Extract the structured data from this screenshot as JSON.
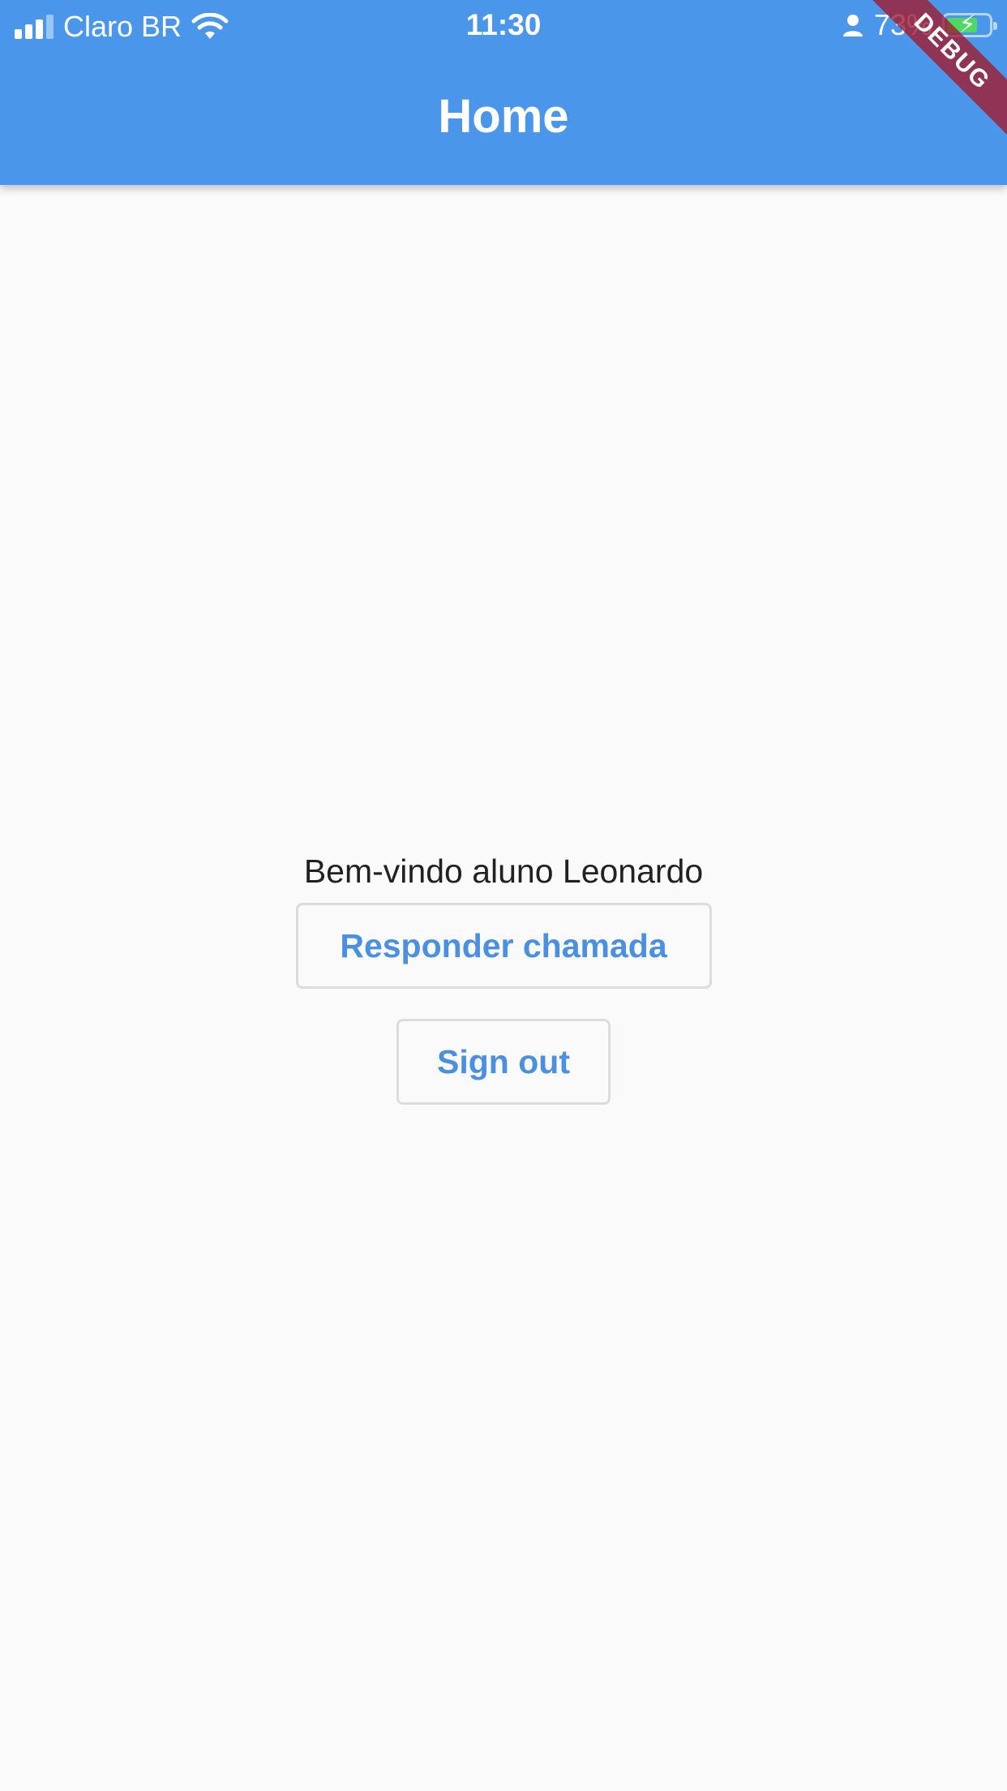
{
  "status_bar": {
    "carrier": "Claro BR",
    "time": "11:30",
    "battery_percent": "73%",
    "battery_level": 0.73,
    "icons": [
      "signal-icon",
      "wifi-icon",
      "person-icon",
      "battery-icon",
      "charging-bolt-icon"
    ]
  },
  "app_bar": {
    "title": "Home",
    "background_color": "#4a96eb"
  },
  "debug_banner": {
    "label": "DEBUG"
  },
  "main": {
    "welcome_text": "Bem-vindo aluno Leonardo",
    "responder_button_label": "Responder chamada",
    "signout_button_label": "Sign out",
    "button_text_color": "#4a90e2"
  }
}
